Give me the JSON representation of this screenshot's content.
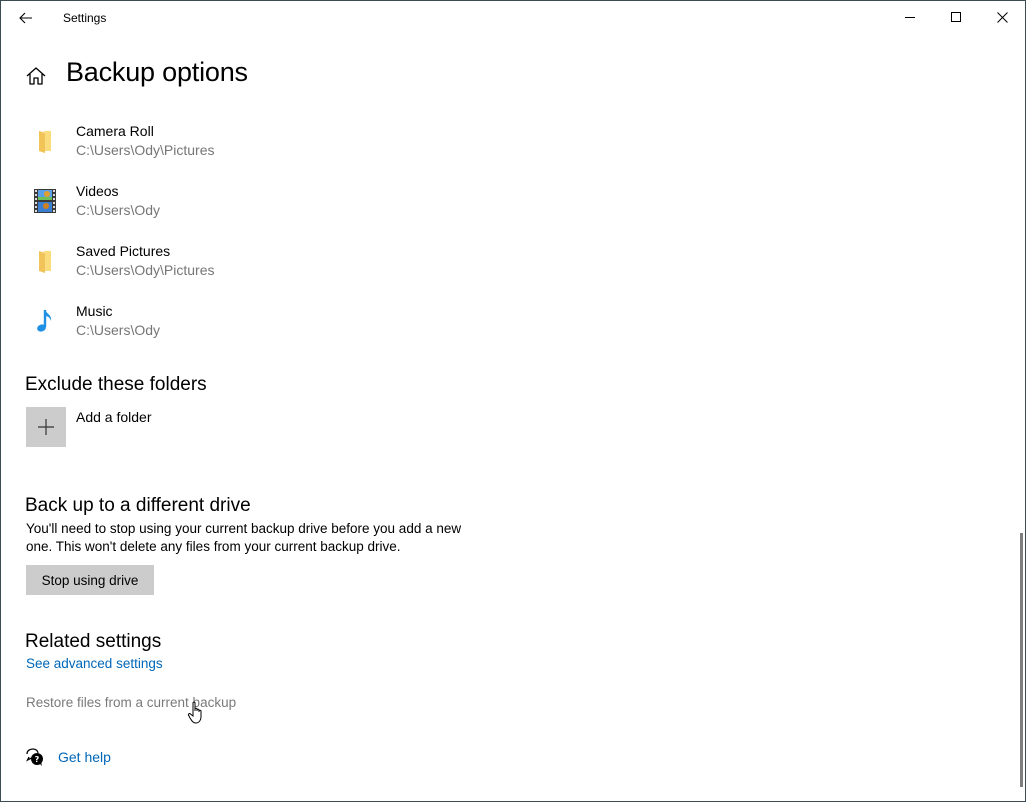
{
  "window": {
    "title": "Settings",
    "controls": {
      "minimize": "minimize",
      "maximize": "maximize",
      "close": "close"
    }
  },
  "header": {
    "title": "Backup options"
  },
  "folders": [
    {
      "name": "Camera Roll",
      "path": "C:\\Users\\Ody\\Pictures",
      "icon": "folder-icon"
    },
    {
      "name": "Videos",
      "path": "C:\\Users\\Ody",
      "icon": "videos-icon"
    },
    {
      "name": "Saved Pictures",
      "path": "C:\\Users\\Ody\\Pictures",
      "icon": "folder-icon"
    },
    {
      "name": "Music",
      "path": "C:\\Users\\Ody",
      "icon": "music-icon"
    }
  ],
  "exclude": {
    "title": "Exclude these folders",
    "add_label": "Add a folder"
  },
  "different_drive": {
    "title": "Back up to a different drive",
    "description": "You'll need to stop using your current backup drive before you add a new one. This won't delete any files from your current backup drive.",
    "button_label": "Stop using drive"
  },
  "related": {
    "title": "Related settings",
    "advanced_link": "See advanced settings",
    "restore_link": "Restore files from a current backup"
  },
  "help": {
    "label": "Get help"
  },
  "colors": {
    "accent": "#0067b8",
    "secondary_text": "#767676",
    "button_bg": "#cccccc"
  }
}
